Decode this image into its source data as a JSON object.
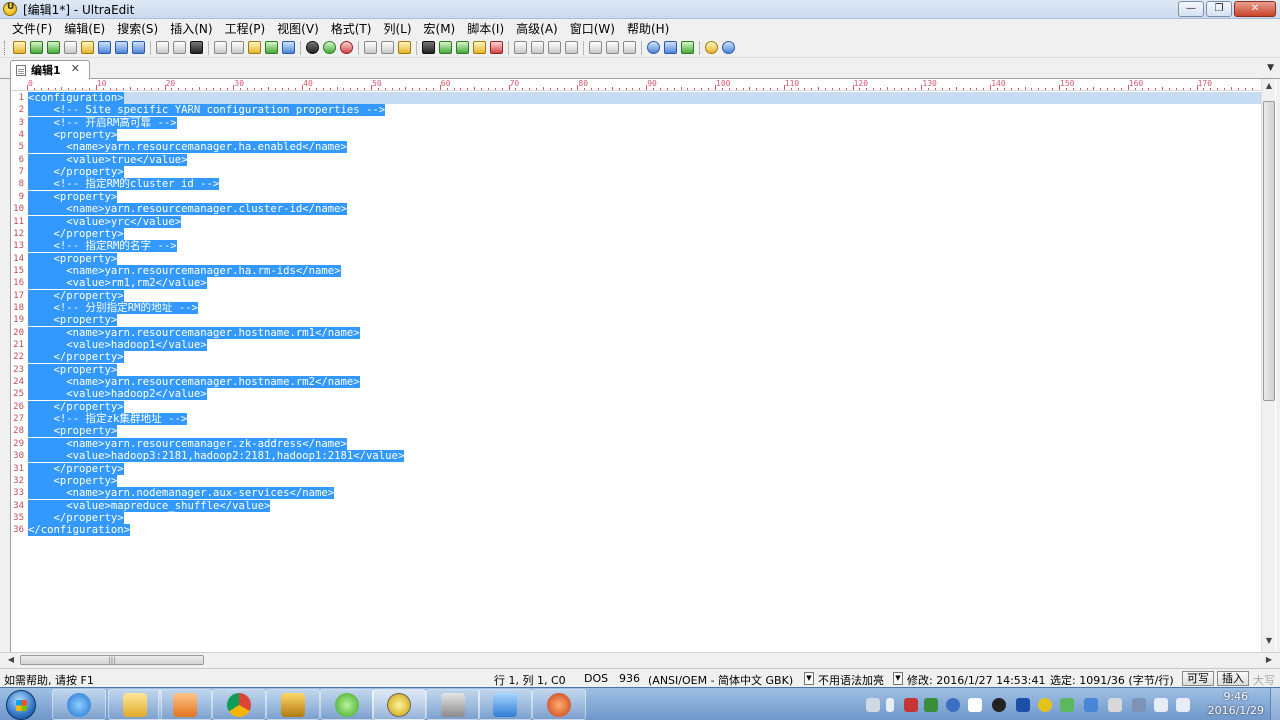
{
  "window": {
    "title": "[编辑1*] - UltraEdit",
    "controls": {
      "minimize": "—",
      "restore": "❐",
      "close": "✕"
    }
  },
  "menu": [
    "文件(F)",
    "编辑(E)",
    "搜索(S)",
    "插入(N)",
    "工程(P)",
    "视图(V)",
    "格式(T)",
    "列(L)",
    "宏(M)",
    "脚本(I)",
    "高级(A)",
    "窗口(W)",
    "帮助(H)"
  ],
  "tab": {
    "label": "编辑1",
    "close": "✕",
    "dropdown": "▼"
  },
  "ruler": [
    "0",
    "10",
    "20",
    "30",
    "40",
    "50",
    "60",
    "70",
    "80",
    "90",
    "100",
    "110",
    "120",
    "130",
    "140",
    "150",
    "160",
    "170"
  ],
  "code_lines": [
    "<configuration>",
    "    <!-- Site specific YARN configuration properties -->",
    "    <!-- 开启RM高可靠 -->",
    "    <property>",
    "      <name>yarn.resourcemanager.ha.enabled</name>",
    "      <value>true</value>",
    "    </property>",
    "    <!-- 指定RM的cluster id -->",
    "    <property>",
    "      <name>yarn.resourcemanager.cluster-id</name>",
    "      <value>yrc</value>",
    "    </property>",
    "    <!-- 指定RM的名字 -->",
    "    <property>",
    "      <name>yarn.resourcemanager.ha.rm-ids</name>",
    "      <value>rm1,rm2</value>",
    "    </property>",
    "    <!-- 分别指定RM的地址 -->",
    "    <property>",
    "      <name>yarn.resourcemanager.hostname.rm1</name>",
    "      <value>hadoop1</value>",
    "    </property>",
    "    <property>",
    "      <name>yarn.resourcemanager.hostname.rm2</name>",
    "      <value>hadoop2</value>",
    "    </property>",
    "    <!-- 指定zk集群地址 -->",
    "    <property>",
    "      <name>yarn.resourcemanager.zk-address</name>",
    "      <value>hadoop3:2181,hadoop2:2181,hadoop1:2181</value>",
    "    </property>",
    "    <property>",
    "      <name>yarn.nodemanager.aux-services</name>",
    "      <value>mapreduce_shuffle</value>",
    "    </property>",
    "</configuration>"
  ],
  "status": {
    "help": "如需帮助, 请按 F1",
    "position": "行 1, 列 1, C0",
    "line_ending": "DOS",
    "codepage": "936",
    "encoding": "(ANSI/OEM - 简体中文 GBK)",
    "highlight": "不用语法加亮",
    "modified": "修改: 2016/1/27 14:53:41",
    "selection": "选定: 1091/36 (字节/行)",
    "writable": "可写",
    "insert": "插入",
    "caps": "大写"
  },
  "taskbar": {
    "time": "9:46",
    "date": "2016/1/29"
  },
  "colors": {
    "selection": "#3399ff",
    "line_number": "#c04a5e",
    "taskbar": "#6f97c9"
  }
}
